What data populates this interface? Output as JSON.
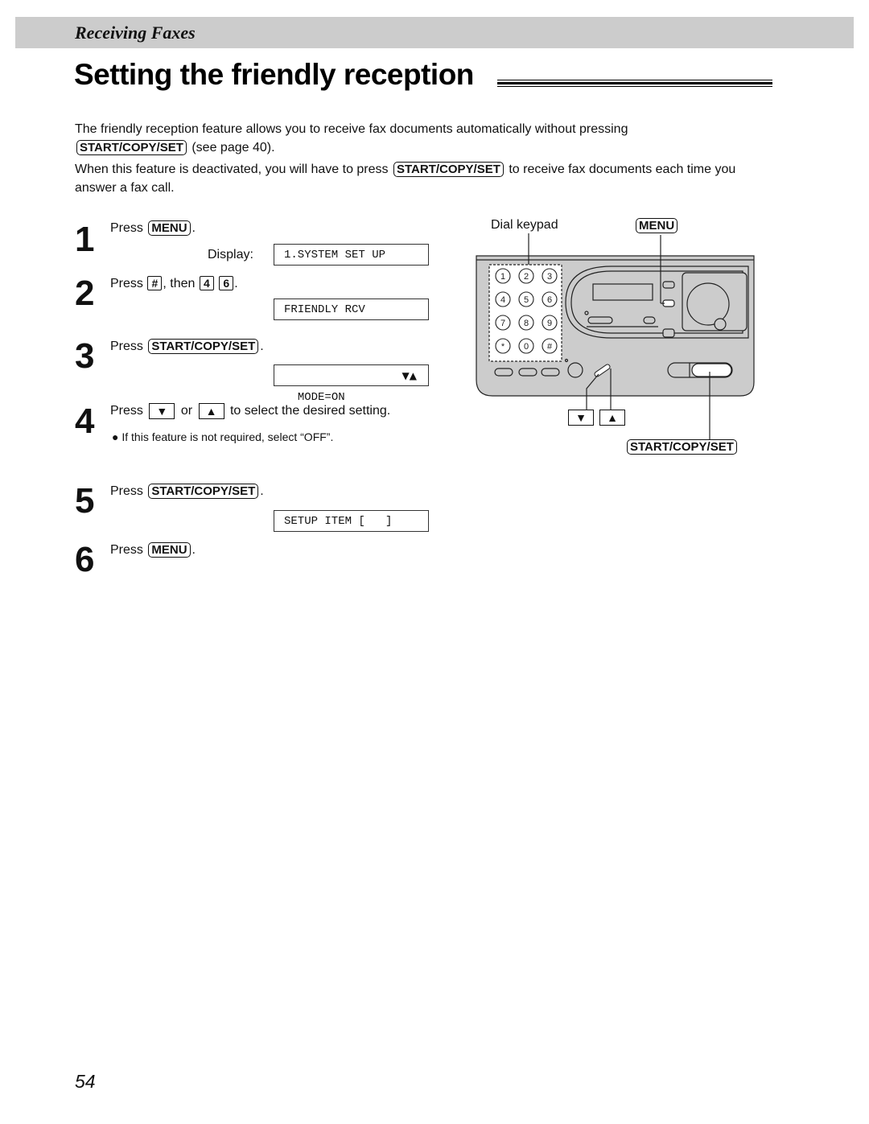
{
  "header": {
    "section": "Receiving Faxes",
    "title": "Setting the friendly reception"
  },
  "intro": {
    "p1_text": "The friendly reception feature allows you to receive fax documents automatically without pressing",
    "p1_key": "START/COPY/SET",
    "p1_tail": " (see page 40).",
    "p2_head": "When this feature is deactivated, you will have to press",
    "p2_key": "START/COPY/SET",
    "p2_tail": "to receive fax documents each time you answer a fax call."
  },
  "steps": [
    {
      "number": "1",
      "press": "Press",
      "key": "MENU",
      "display_label": "Display:",
      "display": "1.SYSTEM SET UP"
    },
    {
      "number": "2",
      "press": "Press",
      "key1": "#",
      "then": ", then",
      "key2": "4",
      "key3": "6",
      "display": "FRIENDLY RCV"
    },
    {
      "number": "3",
      "press": "Press",
      "key": "START/COPY/SET",
      "display": "MODE=ON",
      "display_arrows": "▼▲"
    },
    {
      "number": "4",
      "press": "Press",
      "key_down": "▼",
      "or": "or",
      "key_up": "▲",
      "text": "to select the desired setting.",
      "note": "If this feature is not required, select “OFF”."
    },
    {
      "number": "5",
      "press": "Press",
      "key": "START/COPY/SET",
      "display": "SETUP ITEM [   ]"
    },
    {
      "number": "6",
      "press": "Press",
      "key": "MENU"
    }
  ],
  "diagram": {
    "dial_keypad_label": "Dial keypad",
    "menu_label": "MENU",
    "start_label": "START/COPY/SET",
    "down_label": "▼",
    "up_label": "▲",
    "keypad_keys": [
      "1",
      "2",
      "3",
      "4",
      "5",
      "6",
      "7",
      "8",
      "9",
      "*",
      "0",
      "#"
    ]
  },
  "footer": {
    "page_number": "54"
  }
}
